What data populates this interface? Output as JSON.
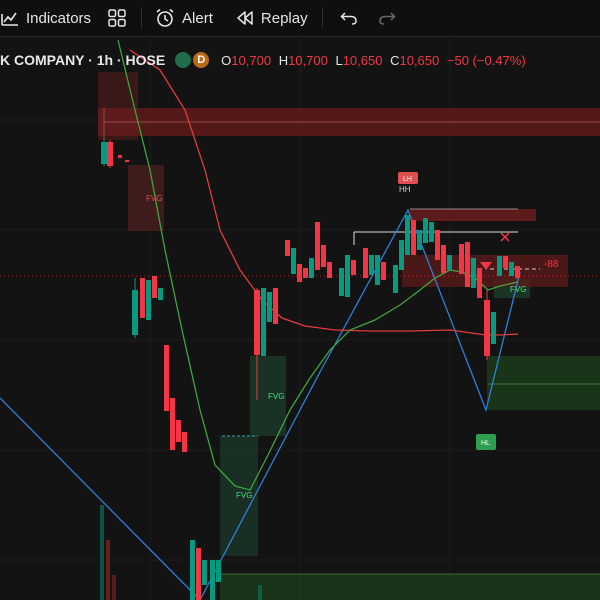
{
  "toolbar": {
    "indicators_label": "Indicators",
    "alert_label": "Alert",
    "replay_label": "Replay"
  },
  "legend": {
    "symbol": "K COMPANY · 1h · HOSE",
    "badge_d": "D",
    "o_key": "O",
    "o_val": "10,700",
    "h_key": "H",
    "h_val": "10,700",
    "l_key": "L",
    "l_val": "10,650",
    "c_key": "C",
    "c_val": "10,650",
    "change": "−50 (−0.47%)"
  },
  "chart_labels": {
    "fvg": "FVG",
    "lh": "LH",
    "hl": "HL",
    "hh": "HH",
    "bars_left": "-88"
  },
  "colors": {
    "bull": "#089981",
    "bear": "#f23645",
    "fast_ma": "#3fa33f",
    "slow_ma": "#e23b3b",
    "zigzag": "#2f7fd8"
  }
}
